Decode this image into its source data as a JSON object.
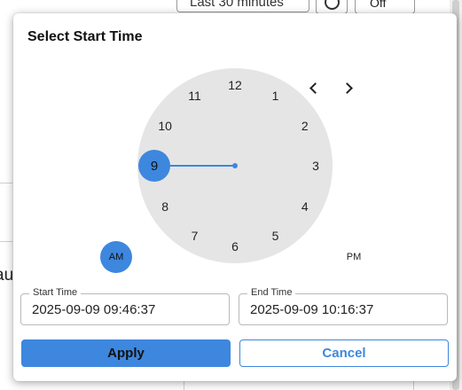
{
  "background": {
    "range_label": "Last 30 minutes",
    "off_label": "Off",
    "partial_text": "au"
  },
  "dialog": {
    "title": "Select Start Time",
    "nav": {
      "prev_icon": "chevron-left-icon",
      "next_icon": "chevron-right-icon"
    },
    "clock": {
      "hours": [
        "12",
        "1",
        "2",
        "3",
        "4",
        "5",
        "6",
        "7",
        "8",
        "9",
        "10",
        "11"
      ],
      "selected_hour": "9",
      "am_label": "AM",
      "pm_label": "PM",
      "selected_period": "AM"
    },
    "start_time": {
      "label": "Start Time",
      "value": "2025-09-09 09:46:37"
    },
    "end_time": {
      "label": "End Time",
      "value": "2025-09-09 10:16:37"
    },
    "apply_label": "Apply",
    "cancel_label": "Cancel"
  },
  "colors": {
    "accent": "#3d87de",
    "clock_face": "#e5e5e5"
  }
}
